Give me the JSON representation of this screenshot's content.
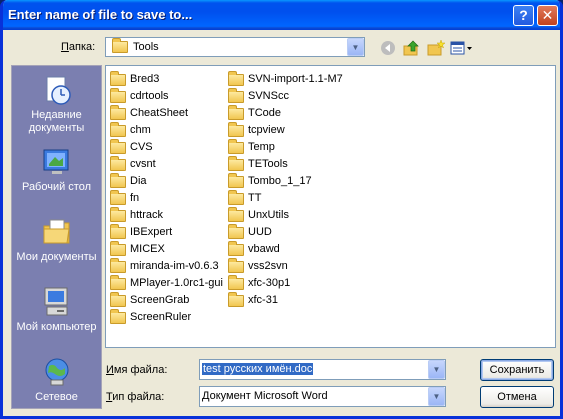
{
  "window": {
    "title": "Enter name of file to save to...",
    "help_label": "?",
    "close_label": "✕"
  },
  "lookin": {
    "label_accel": "П",
    "label_rest": "апка:",
    "value": "Tools"
  },
  "places": [
    {
      "id": "recent",
      "label": "Недавние документы",
      "icon": "recent-documents-icon"
    },
    {
      "id": "desktop",
      "label": "Рабочий стол",
      "icon": "desktop-icon"
    },
    {
      "id": "mydocs",
      "label": "Мои документы",
      "icon": "my-documents-icon"
    },
    {
      "id": "mycomputer",
      "label": "Мой компьютер",
      "icon": "my-computer-icon"
    },
    {
      "id": "network",
      "label": "Сетевое",
      "icon": "network-icon"
    }
  ],
  "files_col1": [
    "Bred3",
    "cdrtools",
    "CheatSheet",
    "chm",
    "CVS",
    "cvsnt",
    "Dia",
    "fn",
    "httrack",
    "IBExpert",
    "MICEX",
    "miranda-im-v0.6.3",
    "MPlayer-1.0rc1-gui",
    "ScreenGrab",
    "ScreenRuler"
  ],
  "files_col2": [
    "SVN-import-1.1-M7",
    "SVNScc",
    "TCode",
    "tcpview",
    "Temp",
    "TETools",
    "Tombo_1_17",
    "TT",
    "UnxUtils",
    "UUD",
    "vbawd",
    "vss2svn",
    "xfc-30p1",
    "xfc-31"
  ],
  "filename": {
    "label_accel": "И",
    "label_rest": "мя файла:",
    "value": "test русских имён.doc"
  },
  "filetype": {
    "label_accel": "Т",
    "label_rest": "ип файла:",
    "value": "Документ Microsoft Word"
  },
  "buttons": {
    "save": "Сохранить",
    "cancel": "Отмена"
  }
}
